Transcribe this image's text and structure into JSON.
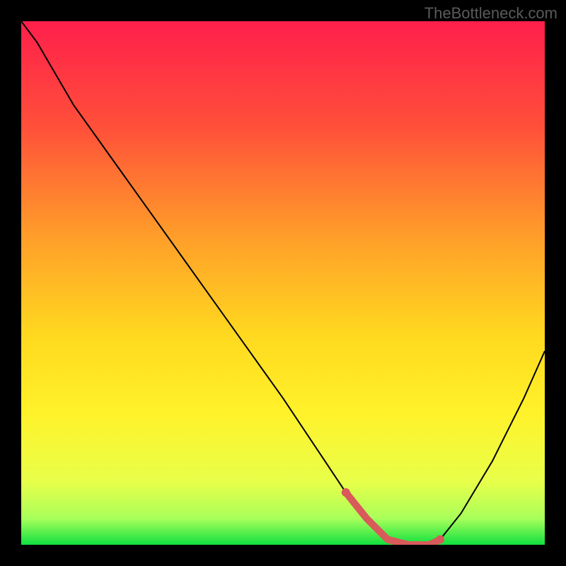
{
  "watermark": "TheBottleneck.com",
  "chart_data": {
    "type": "line",
    "title": "",
    "xlabel": "",
    "ylabel": "",
    "xlim": [
      0,
      100
    ],
    "ylim": [
      0,
      100
    ],
    "x": [
      0,
      3,
      10,
      20,
      30,
      40,
      50,
      58,
      62,
      66,
      70,
      74,
      78,
      80,
      84,
      90,
      96,
      100
    ],
    "values": [
      100,
      96,
      84,
      70,
      56,
      42,
      28,
      16,
      10,
      5,
      1,
      0,
      0,
      1,
      6,
      16,
      28,
      37
    ],
    "highlight_region": {
      "x_start": 62,
      "x_end": 80
    },
    "gradient_stops": [
      {
        "offset": 0.0,
        "color": "#ff1f4b"
      },
      {
        "offset": 0.2,
        "color": "#ff4f3a"
      },
      {
        "offset": 0.4,
        "color": "#ff9a2a"
      },
      {
        "offset": 0.6,
        "color": "#ffd91f"
      },
      {
        "offset": 0.75,
        "color": "#fff22a"
      },
      {
        "offset": 0.88,
        "color": "#e8ff4a"
      },
      {
        "offset": 0.95,
        "color": "#a8ff5a"
      },
      {
        "offset": 1.0,
        "color": "#10e040"
      }
    ]
  }
}
